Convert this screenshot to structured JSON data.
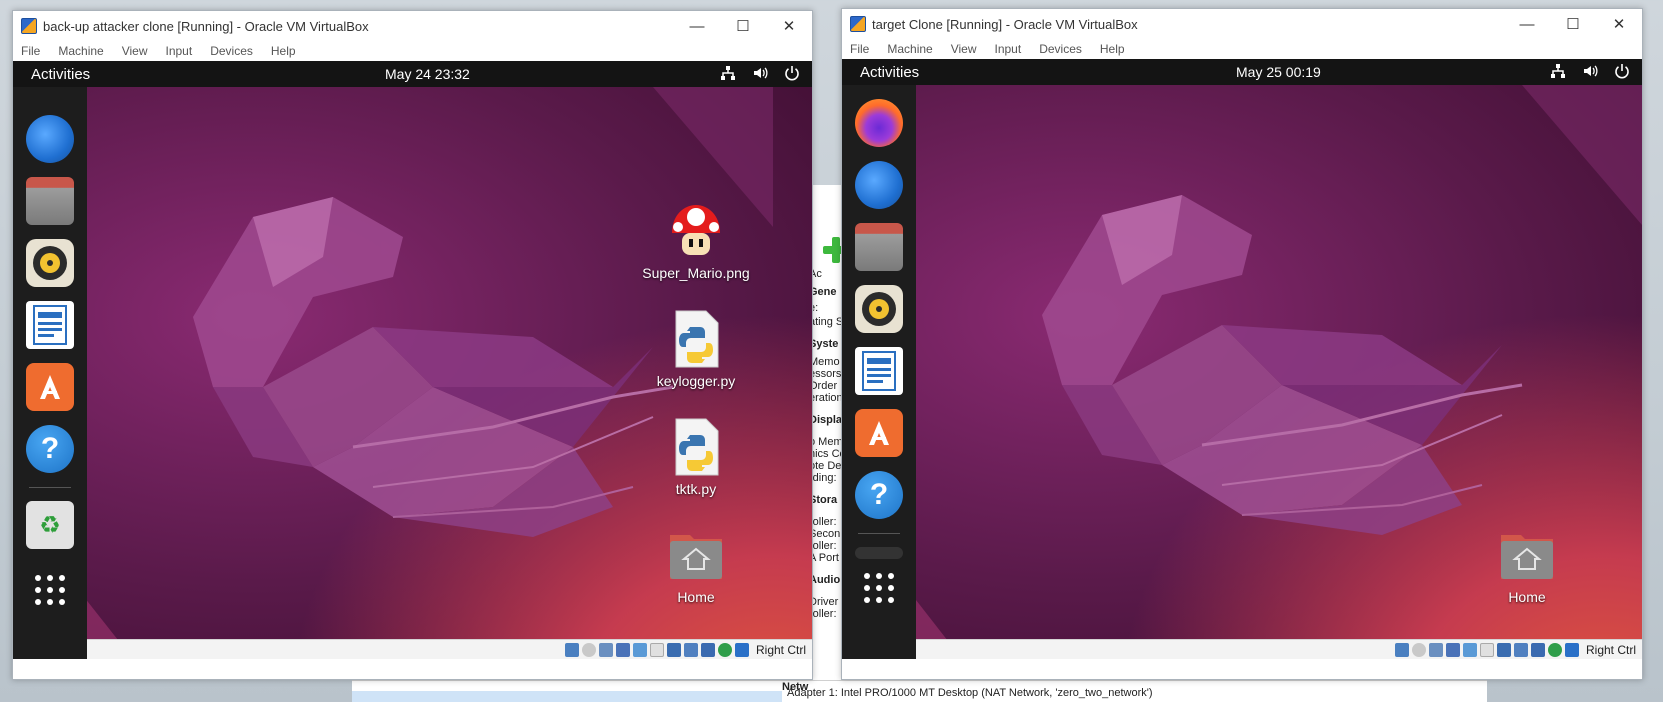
{
  "host": {
    "manager_lines": [
      {
        "text": "Ac",
        "head": false
      },
      {
        "text": "Gene",
        "head": true
      },
      {
        "text": "e:",
        "head": false
      },
      {
        "text": "ating S",
        "head": false
      },
      {
        "text": "Syste",
        "head": true
      },
      {
        "text": "Memo",
        "head": false
      },
      {
        "text": "essors",
        "head": false
      },
      {
        "text": "Order",
        "head": false
      },
      {
        "text": "eration",
        "head": false
      },
      {
        "text": "Displa",
        "head": true
      },
      {
        "text": "o Memo",
        "head": false
      },
      {
        "text": "hics Co",
        "head": false
      },
      {
        "text": "ote De",
        "head": false
      },
      {
        "text": "rding:",
        "head": false
      },
      {
        "text": "Stora",
        "head": true
      },
      {
        "text": "roller:",
        "head": false
      },
      {
        "text": "Secon",
        "head": false
      },
      {
        "text": "roller:",
        "head": false
      },
      {
        "text": "A Port",
        "head": false
      },
      {
        "text": "Audio",
        "head": true
      },
      {
        "text": "Driver",
        "head": false
      },
      {
        "text": "roller:",
        "head": false
      }
    ],
    "network_label": "Netw",
    "adapter_text": "Adapter 1:     Intel PRO/1000 MT Desktop (NAT Network, 'zero_two_network')"
  },
  "left_window": {
    "title": "back-up attacker clone [Running] - Oracle VM VirtualBox",
    "menu": [
      "File",
      "Machine",
      "View",
      "Input",
      "Devices",
      "Help"
    ],
    "activities": "Activities",
    "clock": "May 24  23:32",
    "dock": [
      "thunderbird-icon",
      "files-icon",
      "rhythmbox-icon",
      "writer-icon",
      "software-icon",
      "help-icon",
      "trash-icon"
    ],
    "desktop_icons": [
      {
        "label": "Super_Mario.png",
        "kind": "mushroom"
      },
      {
        "label": "keylogger.py",
        "kind": "python"
      },
      {
        "label": "tktk.py",
        "kind": "python"
      },
      {
        "label": "Home",
        "kind": "home"
      }
    ],
    "host_key": "Right Ctrl"
  },
  "right_window": {
    "title": "target Clone [Running] - Oracle VM VirtualBox",
    "menu": [
      "File",
      "Machine",
      "View",
      "Input",
      "Devices",
      "Help"
    ],
    "activities": "Activities",
    "clock": "May 25  00:19",
    "dock": [
      "firefox-icon",
      "thunderbird-icon",
      "files-icon",
      "rhythmbox-icon",
      "writer-icon",
      "software-icon",
      "help-icon"
    ],
    "desktop_icons": [
      {
        "label": "Home",
        "kind": "home"
      }
    ],
    "host_key": "Right Ctrl"
  },
  "controls": {
    "minimize": "—",
    "maximize": "☐",
    "close": "✕"
  },
  "colors": {
    "topbar": "#141414",
    "dock": "#1d1d1d",
    "accent": "#e95420"
  }
}
